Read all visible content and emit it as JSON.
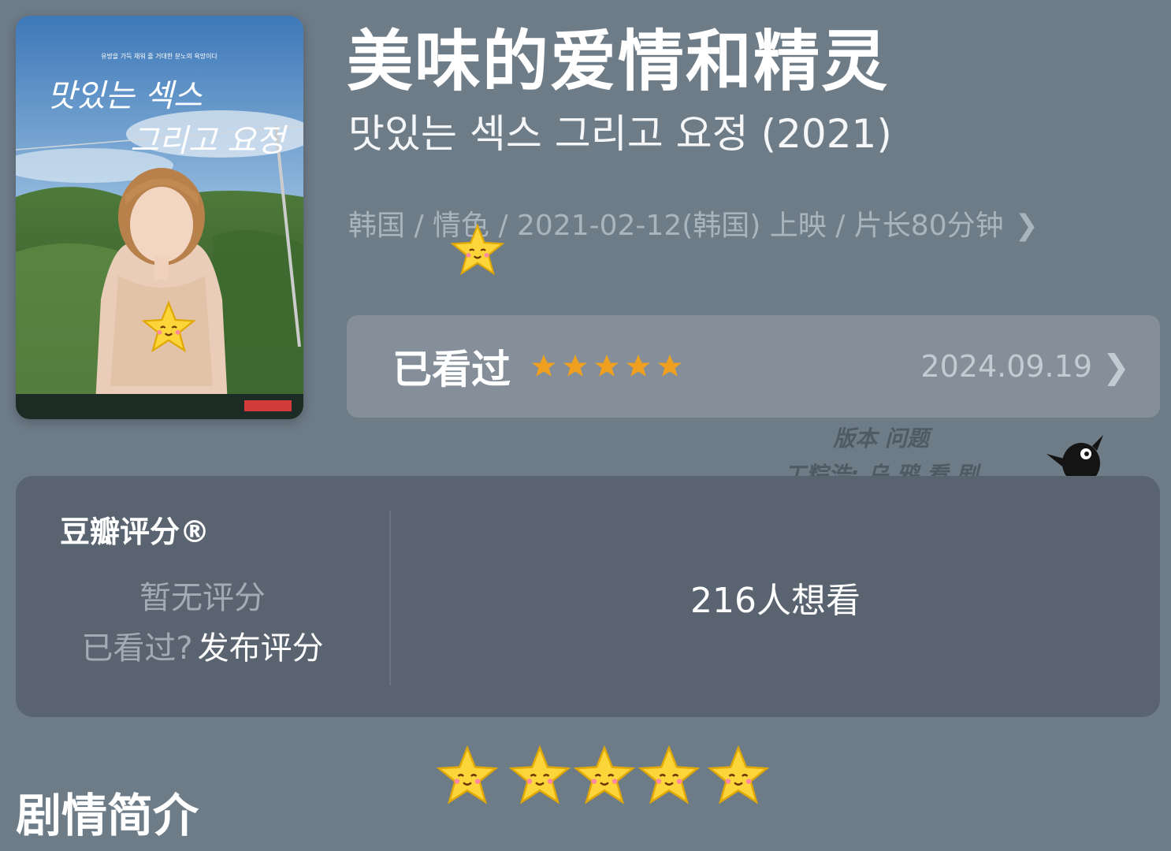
{
  "movie": {
    "title_cn": "美味的爱情和精灵",
    "title_original": "맛있는 섹스 그리고 요정 (2021)",
    "meta_text": "韩国 / 情色 / 2021-02-12(韩国) 上映 / 片长80分钟"
  },
  "poster": {
    "top_text": "유방을 가득 채워 줄 거대한 분노의 욕망이다",
    "title_line1": "맛있는 섹스",
    "title_line2": "그리고 요정"
  },
  "watched": {
    "label": "已看过",
    "stars": 5,
    "date": "2024.09.19"
  },
  "watermark": {
    "line1": "版本 问题",
    "line2": "工粽浩: 乌 鸦 看 剧"
  },
  "rating": {
    "brand": "豆瓣评分®",
    "no_rating": "暂无评分",
    "watched_question": "已看过?",
    "post_rating": "发布评分",
    "wish_count": "216人想看"
  },
  "section": {
    "title": "剧情简介"
  },
  "colors": {
    "background": "#6e7c88",
    "card": "#5a6470",
    "watched_bar": "#848f99",
    "star": "#f0a020"
  }
}
